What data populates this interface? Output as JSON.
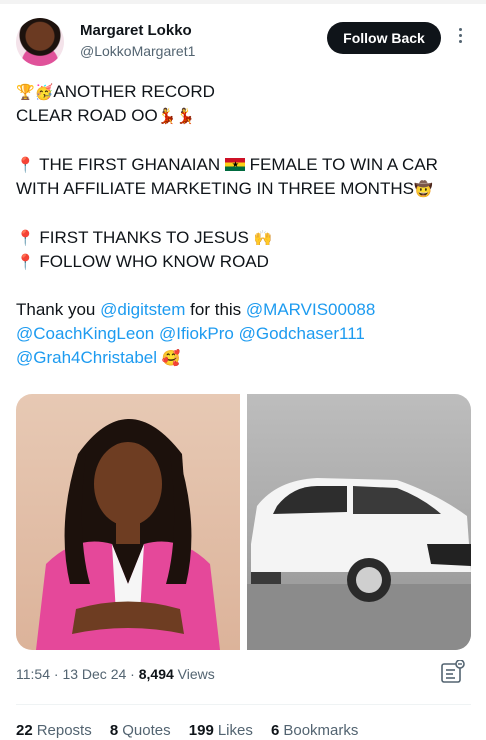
{
  "user": {
    "name": "Margaret Lokko",
    "handle": "@LokkoMargaret1",
    "follow_label": "Follow Back"
  },
  "tweet": {
    "line1_emoji": "🏆🥳",
    "line1": "ANOTHER RECORD",
    "line2": "CLEAR ROAD OO",
    "line2_emoji": "💃💃",
    "pin": "📍",
    "line3a": "THE FIRST GHANAIAN",
    "line3b": "FEMALE TO WIN A CAR",
    "line4": "WITH AFFILIATE MARKETING IN THREE MONTHS",
    "line4_emoji": "🤠",
    "line5": "FIRST THANKS TO JESUS",
    "line5_emoji": "🙌",
    "line6": "FOLLOW WHO KNOW ROAD",
    "thanks_prefix": "Thank you",
    "thanks_mention": "@digitstem",
    "thanks_mid": "for this",
    "mention_marvis": "@MARVIS00088",
    "mention_coach": "@CoachKingLeon",
    "mention_ifiok": "@IfiokPro",
    "mention_godchaser": "@Godchaser111",
    "mention_grah": "@Grah4Christabel",
    "end_emoji": "🥰"
  },
  "flag": {
    "star": "★"
  },
  "meta": {
    "time": "11:54",
    "separator": "·",
    "date": "13 Dec 24",
    "views_count": "8,494",
    "views_label": "Views"
  },
  "stats": {
    "reposts_count": "22",
    "reposts_label": "Reposts",
    "quotes_count": "8",
    "quotes_label": "Quotes",
    "likes_count": "199",
    "likes_label": "Likes",
    "bookmarks_count": "6",
    "bookmarks_label": "Bookmarks"
  },
  "icons": {
    "avatar": "profile-photo",
    "more": "more-vertical-icon",
    "analytics": "analytics-icon"
  },
  "colors": {
    "link": "#1d9bf0",
    "follow_bg": "#0f1419",
    "muted": "#536471"
  }
}
